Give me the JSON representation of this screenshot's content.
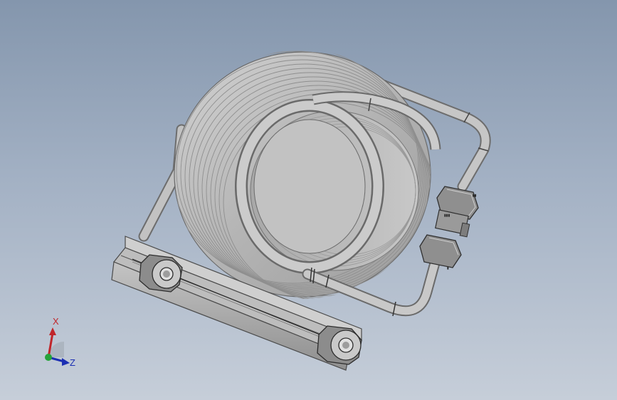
{
  "viewport": {
    "background_top": "#8496ad",
    "background_bottom": "#c6ced9"
  },
  "model": {
    "part_color": "#b9b9b9",
    "edge_color": "#5a5a5a",
    "fitting_color": "#8e8e8e",
    "coil_marker_text": "Ⅱ"
  },
  "triad": {
    "x_label": "X",
    "z_label": "Z",
    "x_color": "#c0262b",
    "y_color": "#25a33a",
    "z_color": "#1b2fb3"
  }
}
